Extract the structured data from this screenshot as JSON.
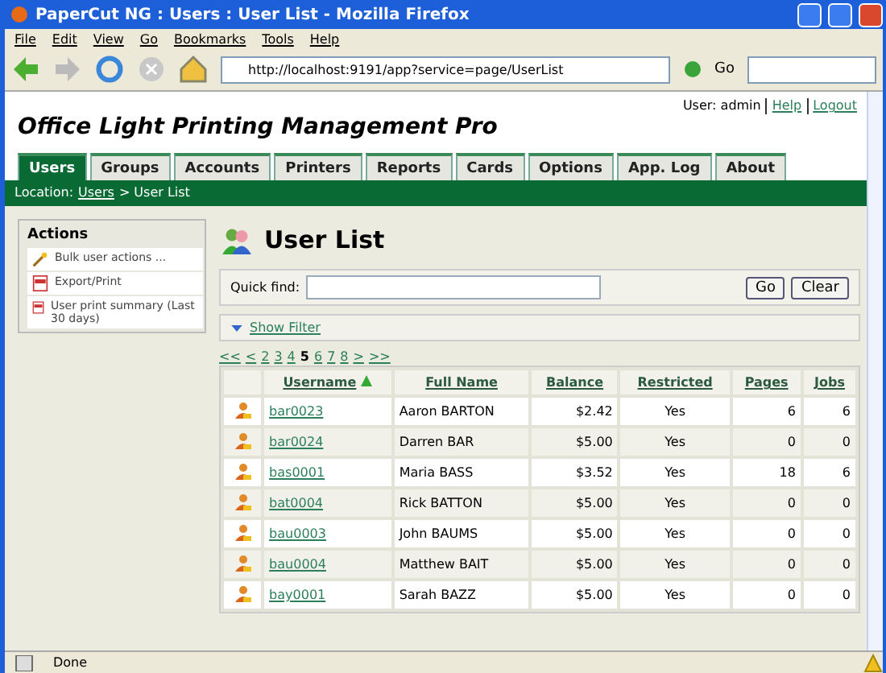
{
  "window": {
    "title": "PaperCut NG : Users : User List - Mozilla Firefox"
  },
  "menu": [
    "File",
    "Edit",
    "View",
    "Go",
    "Bookmarks",
    "Tools",
    "Help"
  ],
  "address": {
    "value": "http://localhost:9191/app?service=page/UserList",
    "go": "Go"
  },
  "app": {
    "title": "Office Light Printing Management Pro",
    "user": "User: admin",
    "links": [
      "Help",
      "Logout"
    ]
  },
  "tabs": [
    {
      "label": "Users",
      "selected": true
    },
    {
      "label": "Groups",
      "selected": false
    },
    {
      "label": "Accounts",
      "selected": false
    },
    {
      "label": "Printers",
      "selected": false
    },
    {
      "label": "Reports",
      "selected": false
    },
    {
      "label": "Cards",
      "selected": false
    },
    {
      "label": "Options",
      "selected": false
    },
    {
      "label": "App. Log",
      "selected": false
    },
    {
      "label": "About",
      "selected": false
    }
  ],
  "location": {
    "label": "Location:",
    "link": "Users",
    "rest": "> User List"
  },
  "actions": {
    "title": "Actions",
    "items": [
      {
        "kind": "wand",
        "label": "Bulk user actions ..."
      },
      {
        "kind": "pdf",
        "label": "Export/Print"
      },
      {
        "kind": "pdf",
        "label": "User print summary (Last 30 days)"
      }
    ]
  },
  "page_title": "User List",
  "quick_find": {
    "label": "Quick find:",
    "buttons": [
      "Go",
      "Clear"
    ]
  },
  "show_filter": "Show Filter",
  "pager": [
    {
      "label": "<<",
      "selected": false
    },
    {
      "label": "<",
      "selected": false
    },
    {
      "label": "2",
      "selected": false
    },
    {
      "label": "3",
      "selected": false
    },
    {
      "label": "4",
      "selected": false
    },
    {
      "label": "5",
      "selected": true
    },
    {
      "label": "6",
      "selected": false
    },
    {
      "label": "7",
      "selected": false
    },
    {
      "label": "8",
      "selected": false
    },
    {
      "label": ">",
      "selected": false
    },
    {
      "label": ">>",
      "selected": false
    }
  ],
  "table": {
    "columns": [
      {
        "label": "Username",
        "sorted": true
      },
      {
        "label": "Full Name",
        "sorted": false
      },
      {
        "label": "Balance",
        "sorted": false
      },
      {
        "label": "Restricted",
        "sorted": false
      },
      {
        "label": "Pages",
        "sorted": false
      },
      {
        "label": "Jobs",
        "sorted": false
      }
    ],
    "rows": [
      [
        "bar0023",
        "Aaron BARTON",
        "$2.42",
        "Yes",
        "6",
        "6"
      ],
      [
        "bar0024",
        "Darren BAR",
        "$5.00",
        "Yes",
        "0",
        "0"
      ],
      [
        "bas0001",
        "Maria BASS",
        "$3.52",
        "Yes",
        "18",
        "6"
      ],
      [
        "bat0004",
        "Rick BATTON",
        "$5.00",
        "Yes",
        "0",
        "0"
      ],
      [
        "bau0003",
        "John BAUMS",
        "$5.00",
        "Yes",
        "0",
        "0"
      ],
      [
        "bau0004",
        "Matthew BAIT",
        "$5.00",
        "Yes",
        "0",
        "0"
      ],
      [
        "bay0001",
        "Sarah BAZZ",
        "$5.00",
        "Yes",
        "0",
        "0"
      ]
    ]
  },
  "status_bar": "Done"
}
